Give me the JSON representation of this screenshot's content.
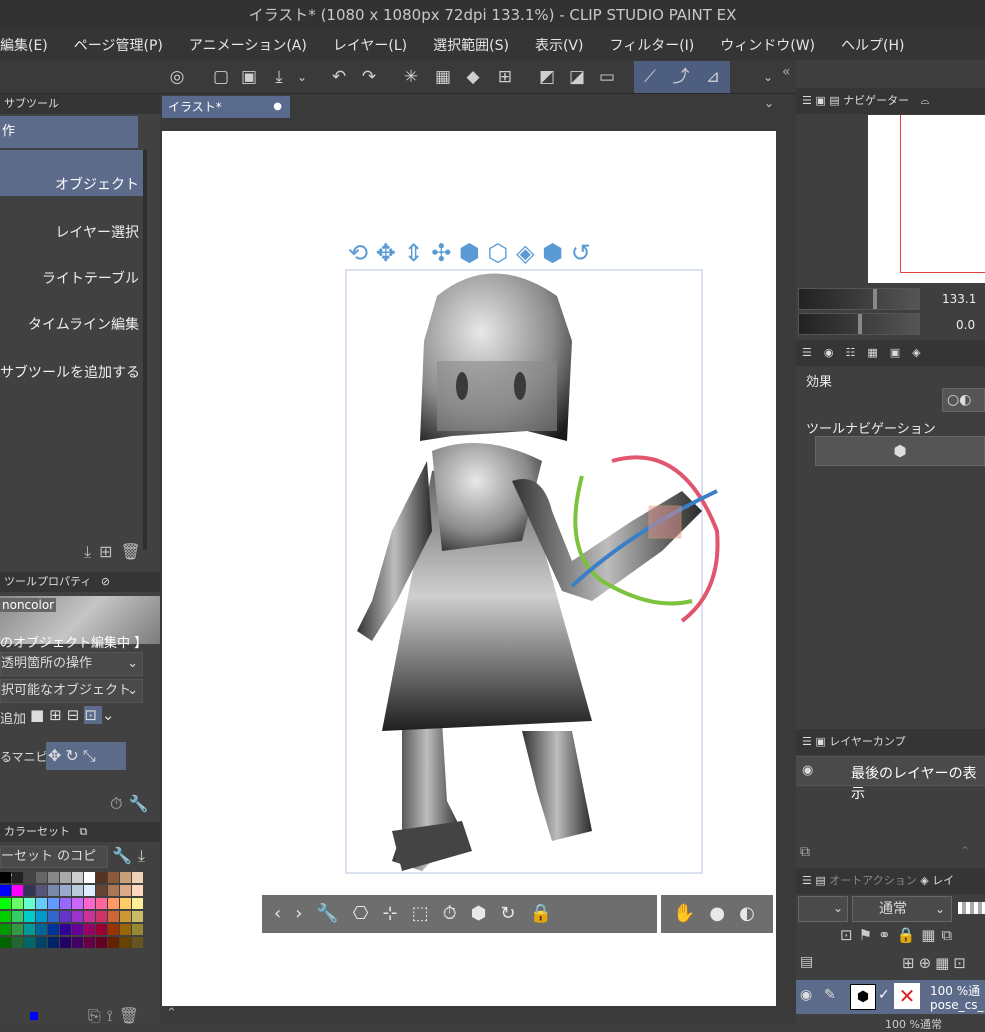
{
  "title": "イラスト* (1080 x 1080px 72dpi 133.1%)  - CLIP STUDIO PAINT EX",
  "menu": [
    "編集(E)",
    "ページ管理(P)",
    "アニメーション(A)",
    "レイヤー(L)",
    "選択範囲(S)",
    "表示(V)",
    "フィルター(I)",
    "ウィンドウ(W)",
    "ヘルプ(H)"
  ],
  "subtool": {
    "tab": "サブツール",
    "header": "作",
    "items": [
      "オブジェクト",
      "レイヤー選択",
      "ライトテーブル",
      "タイムライン編集"
    ],
    "add": "サブツールを追加する"
  },
  "tool_property": {
    "tab": "ツールプロパティ",
    "preview": "noncolor",
    "editing": "のオブジェクト編集中 】",
    "rows": [
      "透明箇所の操作",
      "択可能なオブジェクト",
      "追加",
      "るマニピュ"
    ]
  },
  "color_set": {
    "tab": "カラーセット",
    "name": "ーセット のコピー"
  },
  "document_tab": "イラスト*",
  "navigator": {
    "tab": "ナビゲーター",
    "zoom": "133.1",
    "rotate": "0.0"
  },
  "effect_label": "効果",
  "tool_nav_label": "ツールナビゲーション",
  "layer_comp": {
    "tab": "レイヤーカンプ",
    "row": "最後のレイヤーの表示"
  },
  "layer": {
    "tab_auto": "オートアクション",
    "tab_layer": "レイ",
    "blend": "通常",
    "row_opacity": "100 %通",
    "row_name": "pose_cs_",
    "next_row": "100 %通常"
  },
  "colors": {
    "accent": "#5a6a8c",
    "rotate_red": "#e0566e",
    "rotate_green": "#7cc23c",
    "rotate_blue": "#3a7fc8",
    "gizmo": "#5b9bd5"
  },
  "palette": [
    "#000000",
    "#222222",
    "#444444",
    "#666666",
    "#888888",
    "#aaaaaa",
    "#cccccc",
    "#ffffff",
    "#553322",
    "#8b5a3c",
    "#c8a07a",
    "#f0d2b4",
    "#0000ff",
    "#ff00ff",
    "#333355",
    "#555577",
    "#7788aa",
    "#99aacc",
    "#bbccdd",
    "#ddeeff",
    "#664433",
    "#aa7755",
    "#ddaa88",
    "#ffd8c0",
    "#00ff00",
    "#66ff66",
    "#66ffcc",
    "#66ccff",
    "#6699ff",
    "#9966ff",
    "#cc66ff",
    "#ff66cc",
    "#ff6699",
    "#ff9966",
    "#ffcc66",
    "#ffee99",
    "#00cc00",
    "#33cc66",
    "#00cccc",
    "#0099cc",
    "#3366cc",
    "#6633cc",
    "#9933cc",
    "#cc3399",
    "#cc3366",
    "#cc6633",
    "#cc9933",
    "#ccbb66",
    "#009900",
    "#339944",
    "#009999",
    "#006699",
    "#003399",
    "#330099",
    "#660099",
    "#990066",
    "#990033",
    "#993300",
    "#996600",
    "#998833",
    "#006600",
    "#226633",
    "#006666",
    "#004466",
    "#002266",
    "#220066",
    "#440066",
    "#660044",
    "#660022",
    "#662200",
    "#664400",
    "#665522"
  ]
}
